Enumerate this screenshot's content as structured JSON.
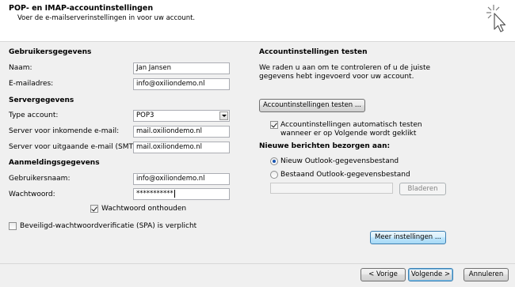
{
  "header": {
    "title": "POP- en IMAP-accountinstellingen",
    "subtitle": "Voer de e-mailserverinstellingen in voor uw account."
  },
  "left": {
    "user_section": "Gebruikersgegevens",
    "name_label": "Naam:",
    "name_value": "Jan Jansen",
    "email_label": "E-mailadres:",
    "email_value": "info@oxiliondemo.nl",
    "server_section": "Servergegevens",
    "account_type_label": "Type account:",
    "account_type_value": "POP3",
    "incoming_label": "Server voor inkomende e-mail:",
    "incoming_value": "mail.oxiliondemo.nl",
    "outgoing_label": "Server voor uitgaande e-mail (SMTP):",
    "outgoing_value": "mail.oxiliondemo.nl",
    "login_section": "Aanmeldingsgegevens",
    "username_label": "Gebruikersnaam:",
    "username_value": "info@oxiliondemo.nl",
    "password_label": "Wachtwoord:",
    "password_value": "***********",
    "remember_label": "Wachtwoord onthouden",
    "remember_checked": true,
    "spa_label": "Beveiligd-wachtwoordverificatie (SPA) is verplicht",
    "spa_checked": false
  },
  "right": {
    "test_section": "Accountinstellingen testen",
    "test_description_1": "We raden u aan om te controleren of u de juiste",
    "test_description_2": "gegevens hebt ingevoerd voor uw account.",
    "test_button": "Accountinstellingen testen ...",
    "auto_test_label_1": "Accountinstellingen automatisch testen",
    "auto_test_label_2": "wanneer er op Volgende wordt geklikt",
    "auto_test_checked": true,
    "deliver_section": "Nieuwe berichten bezorgen aan:",
    "new_file_label": "Nieuw Outlook-gegevensbestand",
    "existing_file_label": "Bestaand Outlook-gegevensbestand",
    "existing_file_value": "",
    "browse_button": "Bladeren",
    "more_settings_button": "Meer instellingen ..."
  },
  "footer": {
    "back_button": "< Vorige",
    "next_button": "Volgende >",
    "cancel_button": "Annuleren"
  }
}
